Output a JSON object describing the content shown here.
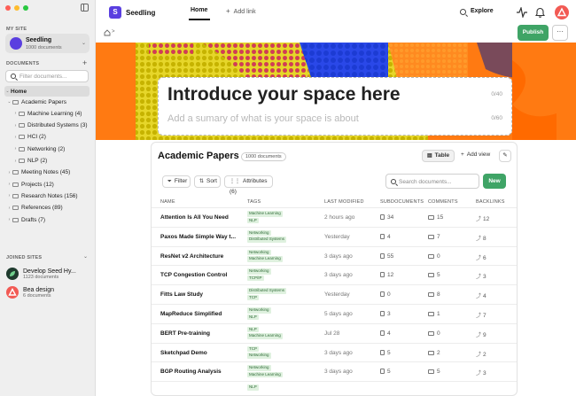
{
  "colors": {
    "accent": "#5a3fe0",
    "publish": "#3fa466",
    "tag_bg": "#dff1df",
    "hero": "#ff7a12"
  },
  "sidebar": {
    "my_site_label": "MY SITE",
    "site": {
      "name": "Seedling",
      "sub": "1000 documents",
      "avatar_color": "#5a3fe0"
    },
    "documents_label": "DOCUMENTS",
    "filter_placeholder": "Filter documents...",
    "home_label": "Home",
    "tree": [
      {
        "label": "Academic Papers",
        "level": 0,
        "open": true
      },
      {
        "label": "Machine Learning (4)",
        "level": 1
      },
      {
        "label": "Distributed Systems (3)",
        "level": 1
      },
      {
        "label": "HCI (2)",
        "level": 1
      },
      {
        "label": "Networking (2)",
        "level": 1
      },
      {
        "label": "NLP (2)",
        "level": 1
      },
      {
        "label": "Meeting Notes (45)",
        "level": 0
      },
      {
        "label": "Projects (12)",
        "level": 0
      },
      {
        "label": "Research Notes (156)",
        "level": 0
      },
      {
        "label": "References (89)",
        "level": 0
      },
      {
        "label": "Drafts (7)",
        "level": 0
      }
    ],
    "joined_label": "JOINED SITES",
    "joined": [
      {
        "name": "Develop Seed Hy...",
        "sub": "1123 documents",
        "icon": "leaf-icon",
        "color": "#1f3b2e"
      },
      {
        "name": "Bea design",
        "sub": "6 documents",
        "icon": "triangle-icon",
        "color": "#f25a54"
      }
    ]
  },
  "topbar": {
    "logo_letter": "S",
    "app_name": "Seedling",
    "home_tab": "Home",
    "add_link": "Add link",
    "explore": "Explore",
    "avatar_icon": "delta-icon"
  },
  "toolbar": {
    "publish": "Publish",
    "more": "···"
  },
  "hero": {
    "title": "Introduce your space here",
    "title_count": "0/40",
    "subtitle": "Add a sumary of what is your space is about",
    "subtitle_count": "0/60"
  },
  "table": {
    "title": "Academic Papers",
    "badge": "1000 documents",
    "view_table": "Table",
    "add_view": "Add view",
    "filter": "Filter",
    "sort": "Sort",
    "attributes": "Attributes (6)",
    "search_placeholder": "Search documents...",
    "new_button": "New",
    "headers": [
      "NAME",
      "TAGS",
      "LAST MODIFIED",
      "SUBDOCUMENTS",
      "COMMENTS",
      "BACKLINKS"
    ],
    "rows": [
      {
        "name": "Attention Is All You Need",
        "tags": [
          "Machine Learning",
          "NLP"
        ],
        "modified": "2 hours ago",
        "subdocs": "34",
        "comments": "15",
        "backlinks": "12"
      },
      {
        "name": "Paxos Made Simple Way t...",
        "tags": [
          "Networking",
          "Distributed Systems"
        ],
        "modified": "Yesterday",
        "subdocs": "4",
        "comments": "7",
        "backlinks": "8"
      },
      {
        "name": "ResNet v2 Architecture",
        "tags": [
          "Networking",
          "Machine Learning"
        ],
        "modified": "3 days ago",
        "subdocs": "55",
        "comments": "0",
        "backlinks": "6"
      },
      {
        "name": "TCP Congestion Control",
        "tags": [
          "Networking",
          "TCP/IP"
        ],
        "modified": "3 days ago",
        "subdocs": "12",
        "comments": "5",
        "backlinks": "3"
      },
      {
        "name": "Fitts Law Study",
        "tags": [
          "Distributed Systems",
          "TCP"
        ],
        "modified": "Yesterday",
        "subdocs": "0",
        "comments": "8",
        "backlinks": "4"
      },
      {
        "name": "MapReduce Simplified",
        "tags": [
          "Networking",
          "NLP"
        ],
        "modified": "5 days ago",
        "subdocs": "3",
        "comments": "1",
        "backlinks": "7"
      },
      {
        "name": "BERT Pre-training",
        "tags": [
          "NLP",
          "Machine Learning"
        ],
        "modified": "Jul 28",
        "subdocs": "4",
        "comments": "0",
        "backlinks": "9"
      },
      {
        "name": "Sketchpad Demo",
        "tags": [
          "TCP",
          "Networking"
        ],
        "modified": "3 days ago",
        "subdocs": "5",
        "comments": "2",
        "backlinks": "2"
      },
      {
        "name": "BGP Routing Analysis",
        "tags": [
          "Networking",
          "Machine Learning"
        ],
        "modified": "3 days ago",
        "subdocs": "5",
        "comments": "5",
        "backlinks": "3"
      },
      {
        "name": "",
        "tags": [
          "NLP"
        ],
        "modified": "",
        "subdocs": "",
        "comments": "",
        "backlinks": ""
      }
    ]
  }
}
